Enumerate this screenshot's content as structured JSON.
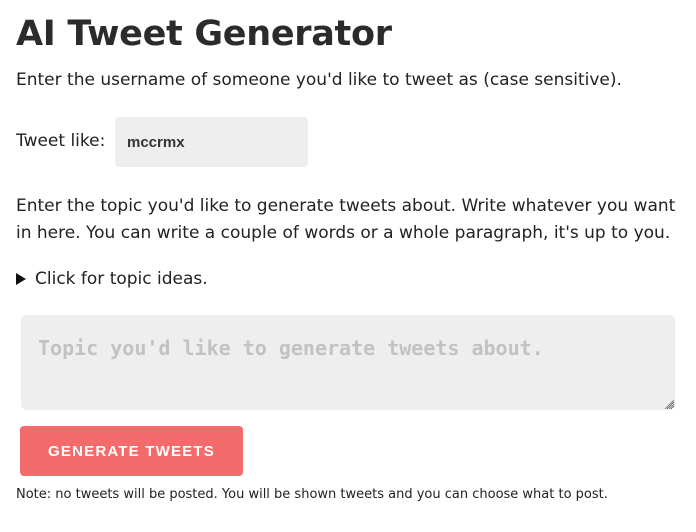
{
  "page": {
    "title": "AI Tweet Generator",
    "intro": "Enter the username of someone you'd like to tweet as (case sensitive)."
  },
  "username": {
    "label": "Tweet like:",
    "value": "mccrmx"
  },
  "topic": {
    "description": "Enter the topic you'd like to generate tweets about. Write whatever you want in here. You can write a couple of words or a whole paragraph, it's up to you.",
    "ideas_toggle": "Click for topic ideas.",
    "placeholder": "Topic you'd like to generate tweets about.",
    "value": ""
  },
  "actions": {
    "generate_label": "GENERATE TWEETS"
  },
  "footer": {
    "note": "Note: no tweets will be posted. You will be shown tweets and you can choose what to post."
  },
  "colors": {
    "button_bg": "#f46b6b",
    "input_bg": "#eeeeee",
    "text": "#222222"
  }
}
